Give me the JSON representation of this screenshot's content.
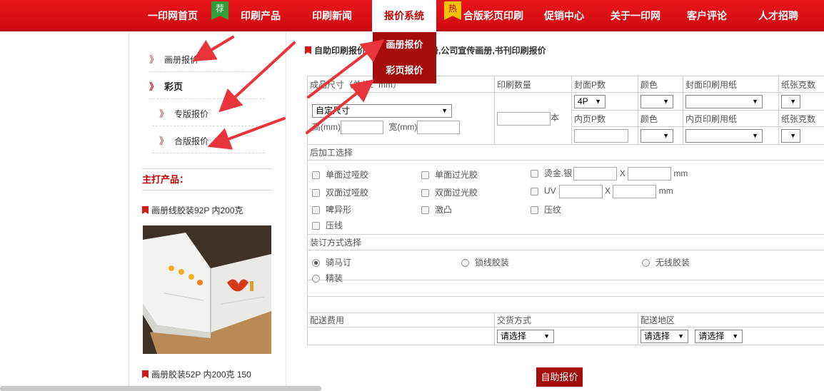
{
  "nav": {
    "items": [
      "一印网首页",
      "印刷产品",
      "印刷新闻",
      "报价系统",
      "合版彩页印刷",
      "促销中心",
      "关于一印网",
      "客户评论",
      "人才招聘"
    ],
    "badges": {
      "recommend": "荐",
      "hot": "热"
    },
    "dropdown": [
      "画册报价",
      "彩页报价"
    ]
  },
  "sidebar": {
    "links": [
      "画册报价",
      "彩页",
      "专版报价",
      "合版报价"
    ],
    "featured_title": "主打产品：",
    "products": [
      "画册线胶装92P 内200克",
      "画册胶装52P 内200克 150"
    ]
  },
  "main": {
    "breadcrumb_left": "自助印刷报价--",
    "breadcrumb_right": "画册,公司宣传画册,书刊印刷报价",
    "headers": {
      "size": "成品尺寸（单位：mm）",
      "qty": "印刷数量",
      "cover_pages": "封面P数",
      "color": "颜色",
      "cover_paper": "封面印刷用纸",
      "paper_weight": "纸张克数",
      "inner_pages": "内页P数",
      "inner_paper": "内页印刷用纸"
    },
    "size_select": "自定尺寸",
    "height_label": "高(mm)",
    "width_label": "宽(mm)",
    "qty_unit": "本",
    "cover_pages_value": "4P",
    "post_title": "后加工选择",
    "post_options": [
      "单面过哑胶",
      "单面过光胶",
      "烫金.银",
      "双面过哑胶",
      "双面过光胶",
      "UV",
      "啤异形",
      "激凸",
      "压纹",
      "压线"
    ],
    "x_sep": "X",
    "mm": "mm",
    "binding_title": "装订方式选择",
    "binding_options": [
      "骑马订",
      "锁线胶装",
      "无线胶装",
      "精装"
    ],
    "shipping_fee": "配送费用",
    "delivery_method": "交货方式",
    "delivery_region": "配送地区",
    "please_select": "请选择",
    "submit": "自助报价"
  },
  "colors": {
    "brand_red": "#d0101a",
    "dark_red": "#a50d0d",
    "annotation_arrow": "#e8343a"
  }
}
